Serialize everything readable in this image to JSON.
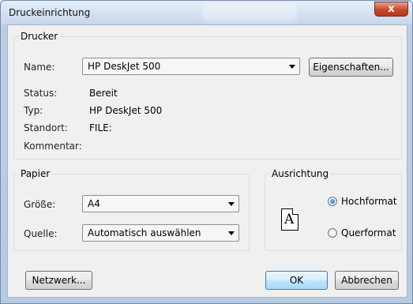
{
  "window": {
    "title": "Druckeinrichtung",
    "close_glyph": "x"
  },
  "printer": {
    "group_label": "Drucker",
    "name_label": "Name:",
    "name_value": "HP DeskJet 500",
    "properties_button": "Eigenschaften...",
    "status_label": "Status:",
    "status_value": "Bereit",
    "type_label": "Typ:",
    "type_value": "HP DeskJet 500",
    "location_label": "Standort:",
    "location_value": "FILE:",
    "comment_label": "Kommentar:"
  },
  "paper": {
    "group_label": "Papier",
    "size_label": "Größe:",
    "size_value": "A4",
    "source_label": "Quelle:",
    "source_value": "Automatisch auswählen"
  },
  "orientation": {
    "group_label": "Ausrichtung",
    "icon_glyph": "A",
    "options": [
      {
        "label": "Hochformat",
        "selected": true
      },
      {
        "label": "Querformat",
        "selected": false
      }
    ]
  },
  "buttons": {
    "network": "Netzwerk...",
    "ok": "OK",
    "cancel": "Abbrechen"
  },
  "icons": {
    "close": "close-icon",
    "dropdown": "chevron-down-icon",
    "orientation": "portrait-page-icon"
  }
}
